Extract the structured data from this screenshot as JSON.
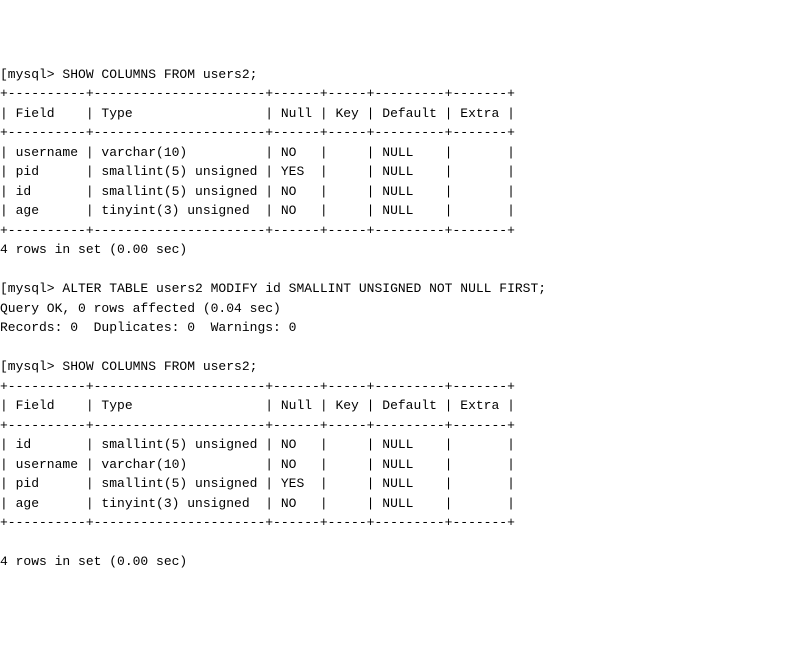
{
  "prompt": "mysql>",
  "bracket": "[",
  "commands": {
    "show1": "SHOW COLUMNS FROM users2;",
    "alter": "ALTER TABLE users2 MODIFY id SMALLINT UNSIGNED NOT NULL FIRST;",
    "show2": "SHOW COLUMNS FROM users2;"
  },
  "table1": {
    "border_top": "+----------+----------------------+------+-----+---------+-------+",
    "header": "| Field    | Type                 | Null | Key | Default | Extra |",
    "border_mid": "+----------+----------------------+------+-----+---------+-------+",
    "rows": [
      "| username | varchar(10)          | NO   |     | NULL    |       |",
      "| pid      | smallint(5) unsigned | YES  |     | NULL    |       |",
      "| id       | smallint(5) unsigned | NO   |     | NULL    |       |",
      "| age      | tinyint(3) unsigned  | NO   |     | NULL    |       |"
    ],
    "border_bot": "+----------+----------------------+------+-----+---------+-------+",
    "footer": "4 rows in set (0.00 sec)"
  },
  "alter_result": {
    "line1": "Query OK, 0 rows affected (0.04 sec)",
    "line2": "Records: 0  Duplicates: 0  Warnings: 0"
  },
  "table2": {
    "border_top": "+----------+----------------------+------+-----+---------+-------+",
    "header": "| Field    | Type                 | Null | Key | Default | Extra |",
    "border_mid": "+----------+----------------------+------+-----+---------+-------+",
    "rows": [
      "| id       | smallint(5) unsigned | NO   |     | NULL    |       |",
      "| username | varchar(10)          | NO   |     | NULL    |       |",
      "| pid      | smallint(5) unsigned | YES  |     | NULL    |       |",
      "| age      | tinyint(3) unsigned  | NO   |     | NULL    |       |"
    ],
    "border_bot": "+----------+----------------------+------+-----+---------+-------+",
    "footer": "4 rows in set (0.00 sec)"
  },
  "chart_data": {
    "type": "table",
    "tables": [
      {
        "title": "SHOW COLUMNS FROM users2 (before ALTER)",
        "columns": [
          "Field",
          "Type",
          "Null",
          "Key",
          "Default",
          "Extra"
        ],
        "rows": [
          {
            "Field": "username",
            "Type": "varchar(10)",
            "Null": "NO",
            "Key": "",
            "Default": "NULL",
            "Extra": ""
          },
          {
            "Field": "pid",
            "Type": "smallint(5) unsigned",
            "Null": "YES",
            "Key": "",
            "Default": "NULL",
            "Extra": ""
          },
          {
            "Field": "id",
            "Type": "smallint(5) unsigned",
            "Null": "NO",
            "Key": "",
            "Default": "NULL",
            "Extra": ""
          },
          {
            "Field": "age",
            "Type": "tinyint(3) unsigned",
            "Null": "NO",
            "Key": "",
            "Default": "NULL",
            "Extra": ""
          }
        ],
        "footer": "4 rows in set (0.00 sec)"
      },
      {
        "title": "SHOW COLUMNS FROM users2 (after ALTER)",
        "columns": [
          "Field",
          "Type",
          "Null",
          "Key",
          "Default",
          "Extra"
        ],
        "rows": [
          {
            "Field": "id",
            "Type": "smallint(5) unsigned",
            "Null": "NO",
            "Key": "",
            "Default": "NULL",
            "Extra": ""
          },
          {
            "Field": "username",
            "Type": "varchar(10)",
            "Null": "NO",
            "Key": "",
            "Default": "NULL",
            "Extra": ""
          },
          {
            "Field": "pid",
            "Type": "smallint(5) unsigned",
            "Null": "YES",
            "Key": "",
            "Default": "NULL",
            "Extra": ""
          },
          {
            "Field": "age",
            "Type": "tinyint(3) unsigned",
            "Null": "NO",
            "Key": "",
            "Default": "NULL",
            "Extra": ""
          }
        ],
        "footer": "4 rows in set (0.00 sec)"
      }
    ]
  }
}
